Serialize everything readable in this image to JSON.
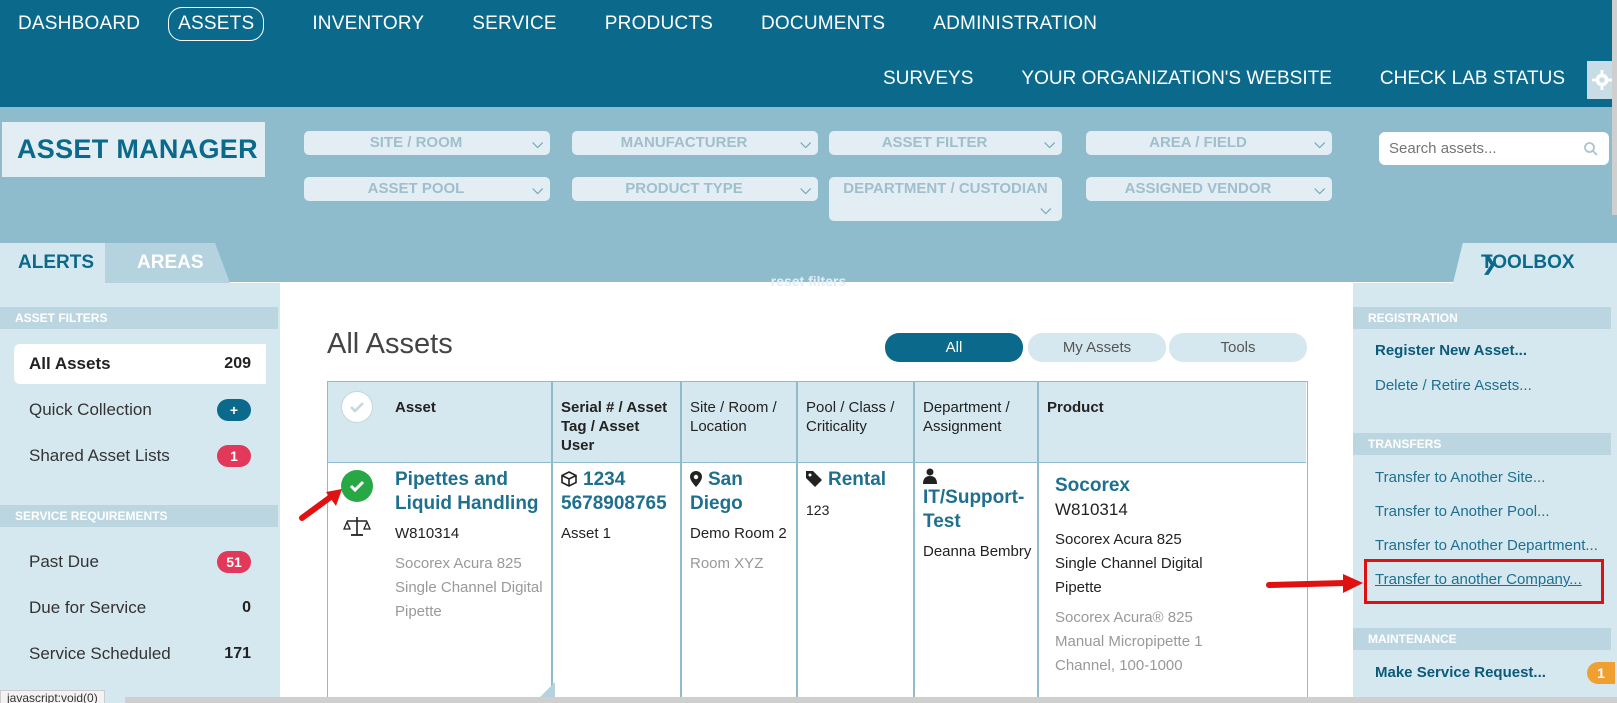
{
  "nav": {
    "primary": [
      "DASHBOARD",
      "ASSETS",
      "INVENTORY",
      "SERVICE",
      "PRODUCTS",
      "DOCUMENTS",
      "ADMINISTRATION"
    ],
    "secondary": [
      "SURVEYS",
      "YOUR ORGANIZATION'S WEBSITE",
      "CHECK LAB STATUS"
    ],
    "active": "ASSETS"
  },
  "header": {
    "title": "ASSET MANAGER"
  },
  "filters": {
    "site_room": "SITE / ROOM",
    "manufacturer": "MANUFACTURER",
    "asset_filter": "ASSET FILTER",
    "area_field": "AREA / FIELD",
    "asset_pool": "ASSET POOL",
    "product_type": "PRODUCT TYPE",
    "department_custodian": "DEPARTMENT / CUSTODIAN",
    "assigned_vendor": "ASSIGNED VENDOR",
    "reset": "reset filters"
  },
  "search": {
    "placeholder": "Search assets..."
  },
  "tabs": {
    "alerts": "ALERTS",
    "areas": "AREAS",
    "toolbox": "TOOLBOX"
  },
  "left": {
    "asset_filters_header": "ASSET FILTERS",
    "all_assets": {
      "label": "All Assets",
      "count": "209"
    },
    "quick_collection": {
      "label": "Quick Collection",
      "badge": "+"
    },
    "shared_lists": {
      "label": "Shared Asset Lists",
      "badge": "1"
    },
    "service_header": "SERVICE REQUIREMENTS",
    "past_due": {
      "label": "Past Due",
      "badge": "51"
    },
    "due_for_service": {
      "label": "Due for Service",
      "count": "0"
    },
    "service_scheduled": {
      "label": "Service Scheduled",
      "count": "171"
    }
  },
  "main": {
    "title": "All Assets",
    "views": [
      "All",
      "My Assets",
      "Tools"
    ],
    "columns": {
      "asset": "Asset",
      "serial": "Serial # / Asset Tag / Asset User",
      "site": "Site / Room / Location",
      "pool": "Pool / Class / Criticality",
      "department": "Department / Assignment",
      "product": "Product"
    },
    "row": {
      "asset_name": "Pipettes and Liquid Handling",
      "asset_code": "W810314",
      "asset_desc": "Socorex Acura 825 Single Channel Digital Pipette",
      "serial": "1234 5678908765",
      "asset_user": "Asset 1",
      "site": "San Diego",
      "room": "Demo Room 2",
      "location": "Room XYZ",
      "pool": "Rental",
      "class": "123",
      "department": "IT/Support-Test",
      "assignment": "Deanna Bembry",
      "product_brand": "Socorex",
      "product_code": "W810314",
      "product_name": "Socorex Acura 825 Single Channel Digital Pipette",
      "product_desc": "Socorex Acura® 825 Manual Micropipette 1 Channel, 100-1000"
    }
  },
  "toolbox": {
    "registration_header": "REGISTRATION",
    "register_new": "Register New Asset...",
    "delete_retire": "Delete / Retire Assets...",
    "transfers_header": "TRANSFERS",
    "transfer_site": "Transfer to Another Site...",
    "transfer_pool": "Transfer to Another Pool...",
    "transfer_department": "Transfer to Another Department...",
    "transfer_company": "Transfer to another Company...",
    "maintenance_header": "MAINTENANCE",
    "make_service": "Make Service Request...",
    "make_service_badge": "1"
  },
  "status_bar": "javascript:void(0)",
  "colors": {
    "brand": "#0b6a8b",
    "band": "#8fbccd",
    "panel": "#d6e8ef",
    "alert": "#e2385a",
    "ok": "#28a745",
    "highlight": "#dd1111"
  }
}
